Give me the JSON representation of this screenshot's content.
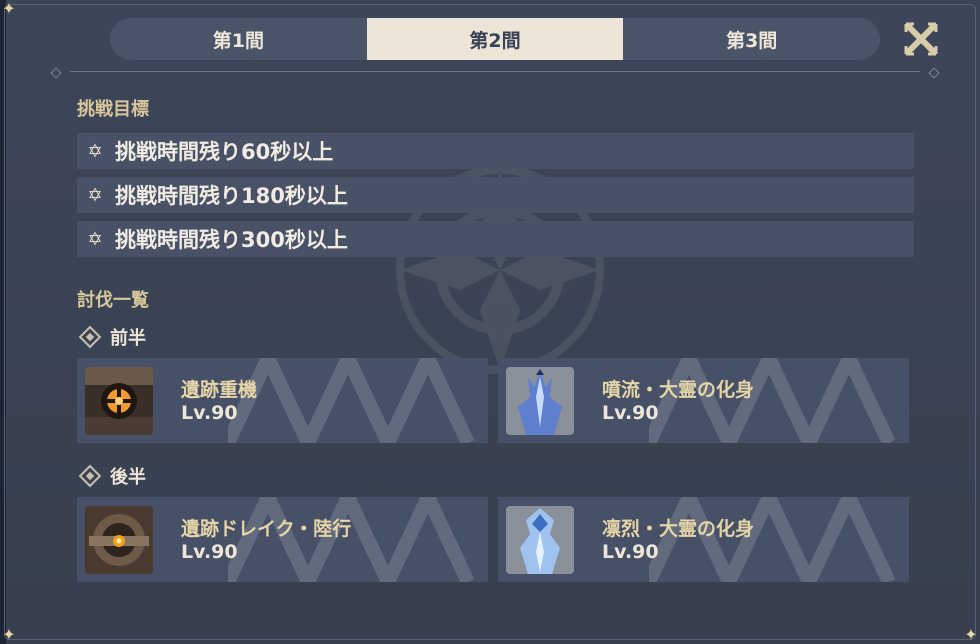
{
  "tabs": [
    {
      "label": "第1間",
      "active": false
    },
    {
      "label": "第2間",
      "active": true
    },
    {
      "label": "第3間",
      "active": false
    }
  ],
  "close_icon": "close-x-icon",
  "challenge": {
    "title": "挑戦目標",
    "goals": [
      {
        "icon": "star-icon",
        "text": "挑戦時間残り60秒以上"
      },
      {
        "icon": "star-icon",
        "text": "挑戦時間残り180秒以上"
      },
      {
        "icon": "star-icon",
        "text": "挑戦時間残り300秒以上"
      }
    ]
  },
  "enemies": {
    "title": "討伐一覧",
    "first_half": {
      "label": "前半",
      "items": [
        {
          "name": "遺跡重機",
          "level": "Lv.90",
          "portrait": "ruin-grader-portrait"
        },
        {
          "name": "噴流・大霊の化身",
          "level": "Lv.90",
          "portrait": "hydro-ice-avatar-portrait"
        }
      ]
    },
    "second_half": {
      "label": "後半",
      "items": [
        {
          "name": "遺跡ドレイク・陸行",
          "level": "Lv.90",
          "portrait": "ruin-drake-portrait"
        },
        {
          "name": "凛烈・大霊の化身",
          "level": "Lv.90",
          "portrait": "cryo-avatar-portrait"
        }
      ]
    }
  },
  "colors": {
    "panel_bg": "#3d4659",
    "accent_gold": "#d8c79b",
    "tab_active_bg": "#ece5d8",
    "row_bg": "#495166"
  }
}
